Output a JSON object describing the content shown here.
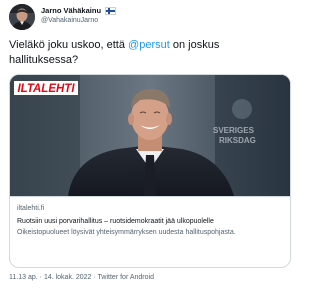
{
  "author": {
    "display_name": "Jarno Vähäkainu",
    "flag_icon": "finland-flag-icon",
    "handle": "@VahakainuJarno"
  },
  "tweet": {
    "text_before": "Vieläkö joku uskoo, että ",
    "mention": "@persut",
    "text_after": " on joskus hallituksessa?"
  },
  "card": {
    "logo_text": "ILTALEHTI",
    "logo_color": "#e30613",
    "backdrop_text_1": "SVERIGES",
    "backdrop_text_2": "RIKSDAG",
    "domain": "iltalehti.fi",
    "title": "Ruotsiin uusi porvarihallitus – ruotsidemokraatit jää ulkopuolelle",
    "description": "Oikeistopuolueet löysivät yhteisymmärryksen uudesta hallituspohjasta."
  },
  "footer": {
    "time": "11.13 ap.",
    "separator": "·",
    "date": "14. lokak. 2022",
    "client": "Twitter for Android"
  },
  "colors": {
    "mention": "#1d9bf0",
    "secondary_text": "#536471",
    "border": "#cfd9de"
  }
}
